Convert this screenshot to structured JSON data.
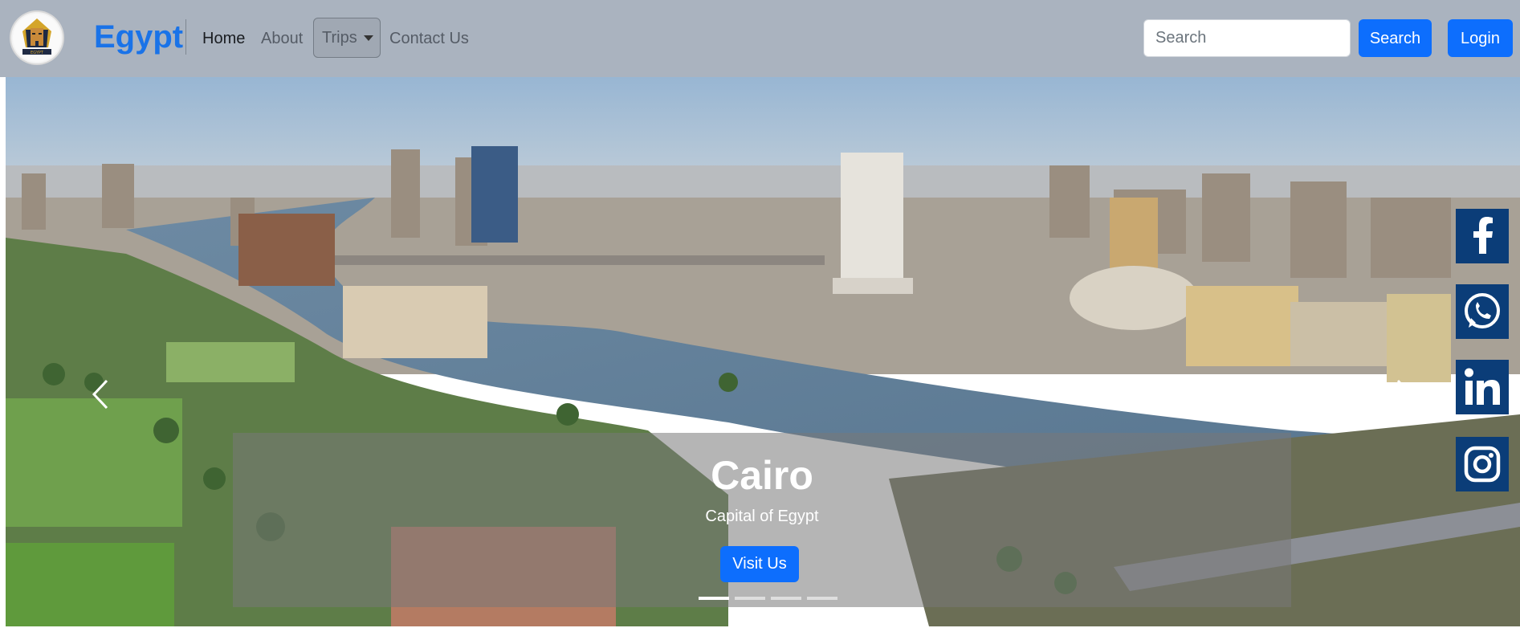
{
  "navbar": {
    "brand": "Egypt",
    "links": [
      "Home",
      "About",
      "Trips",
      "Contact Us"
    ],
    "search_placeholder": "Search",
    "search_button": "Search",
    "login_button": "Login"
  },
  "hero": {
    "slide_title": "Cairo",
    "slide_subtitle": "Capital of Egypt",
    "cta_label": "Visit Us",
    "indicator_count": 4,
    "active_indicator": 1
  },
  "social": [
    "facebook-icon",
    "whatsapp-icon",
    "linkedin-icon",
    "instagram-icon"
  ],
  "colors": {
    "navbar_bg": "#aab3bf",
    "brand": "#1a73e8",
    "primary": "#0d6efd",
    "social_bg": "#0b3d78"
  }
}
